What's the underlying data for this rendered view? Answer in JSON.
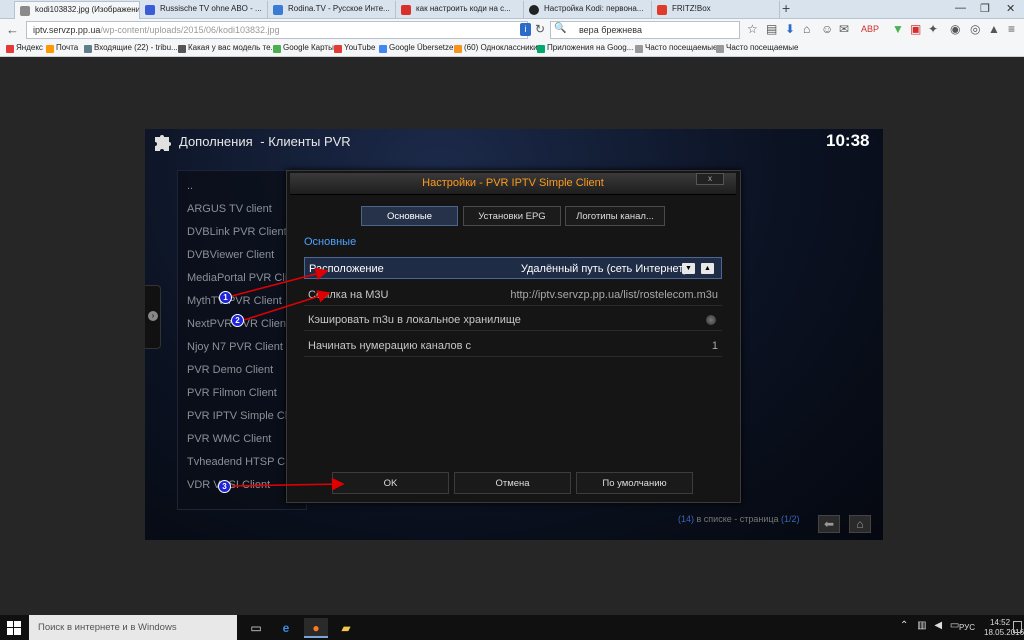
{
  "browser": {
    "tabs": [
      {
        "label": "kodi103832.jpg (Изображени...",
        "color": "#888888",
        "active": true
      },
      {
        "label": "Russische TV ohne ABO - ...",
        "color": "#3b5bd8"
      },
      {
        "label": "Rodina.TV - Русское Инте...",
        "color": "#3a7bd5"
      },
      {
        "label": "как настроить коди на с...",
        "color": "#d9302c"
      },
      {
        "label": "Настройка Kodi: первона...",
        "color": "#222222"
      },
      {
        "label": "FRITZ!Box",
        "color": "#e03a2a"
      }
    ],
    "new_tab": "+",
    "url_prefix": "iptv.servzp.pp.ua",
    "url_rest": "/wp-content/uploads/2015/06/kodi103832.jpg",
    "search_value": "вера брежнева",
    "bookmarks": [
      {
        "label": "Яндекс",
        "color": "#e53935"
      },
      {
        "label": "Почта",
        "color": "#ff9800"
      },
      {
        "label": "Входящие (22) - tribu...",
        "color": "#607d8b"
      },
      {
        "label": "Какая у вас модель те...",
        "color": "#555555"
      },
      {
        "label": "Google Карты",
        "color": "#4caf50"
      },
      {
        "label": "YouTube",
        "color": "#e53935"
      },
      {
        "label": "Google Übersetzer",
        "color": "#4285f4"
      },
      {
        "label": "(60) Одноклассники",
        "color": "#f7931e"
      },
      {
        "label": "Приложения на Goog...",
        "color": "#00a86b"
      },
      {
        "label": "Часто посещаемые",
        "color": "#999999"
      },
      {
        "label": "Часто посещаемые",
        "color": "#999999"
      }
    ]
  },
  "kodi": {
    "header_title": "Дополнения",
    "header_sub": "- Клиенты PVR",
    "clock": "10:38",
    "list_items": [
      "..",
      "ARGUS TV client",
      "DVBLink PVR Client",
      "DVBViewer Client",
      "MediaPortal PVR Client",
      "MythTV PVR Client",
      "NextPVR PVR Client",
      "Njoy N7 PVR Client",
      "PVR Demo Client",
      "PVR Filmon Client",
      "PVR IPTV Simple Client",
      "PVR WMC Client",
      "Tvheadend HTSP Client",
      "VDR VNSI Client"
    ],
    "footer_count": "(14)",
    "footer_mid": " в списке - страница ",
    "footer_page": "(1/2)",
    "dialog": {
      "title": "Настройки - PVR IPTV Simple Client",
      "close": "x",
      "tabs": [
        "Основные",
        "Установки EPG",
        "Логотипы канал..."
      ],
      "section": "Основные",
      "settings": [
        {
          "label": "Расположение",
          "value": "Удалённый путь (сеть Интернет)"
        },
        {
          "label": "Ссылка на M3U",
          "value": "http://iptv.servzp.pp.ua/list/rostelecom.m3u"
        },
        {
          "label": "Кэшировать m3u в локальное хранилище",
          "value": ""
        },
        {
          "label": "Начинать нумерацию каналов с",
          "value": "1"
        }
      ],
      "buttons": [
        "OK",
        "Отмена",
        "По умолчанию"
      ]
    },
    "markers": [
      "1",
      "2",
      "3"
    ],
    "arrow_color": "#e00000"
  },
  "taskbar": {
    "search_placeholder": "Поиск в интернете и в Windows",
    "lang": "РУС",
    "time": "14:52",
    "date": "18.05.2016"
  }
}
